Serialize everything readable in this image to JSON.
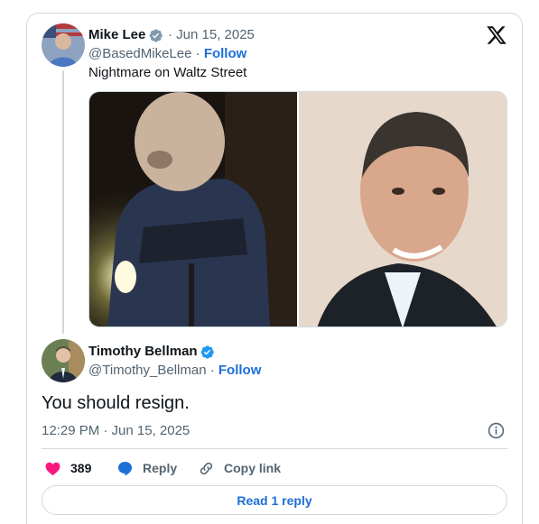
{
  "quoted_tweet": {
    "author_name": "Mike Lee",
    "date": "· Jun 15, 2025",
    "handle": "@BasedMikeLee",
    "separator": " · ",
    "follow_label": "Follow",
    "text": "Nightmare on Waltz Street",
    "icons": {
      "verified": "verified-badge-icon",
      "brand": "x-logo-icon"
    }
  },
  "reply_tweet": {
    "author_name": "Timothy Bellman",
    "handle": "@Timothy_Bellman",
    "separator": " · ",
    "follow_label": "Follow",
    "text": "You should resign.",
    "timestamp": "12:29 PM · Jun 15, 2025"
  },
  "actions": {
    "like_count": "389",
    "reply_label": "Reply",
    "copy_link_label": "Copy link"
  },
  "read_replies_label": "Read 1 reply",
  "colors": {
    "accent": "#1d6fd8",
    "verified": "#1d9bf0",
    "like": "#f91880",
    "text_primary": "#0f1419",
    "text_secondary": "#536471",
    "border": "#cfd9de"
  }
}
